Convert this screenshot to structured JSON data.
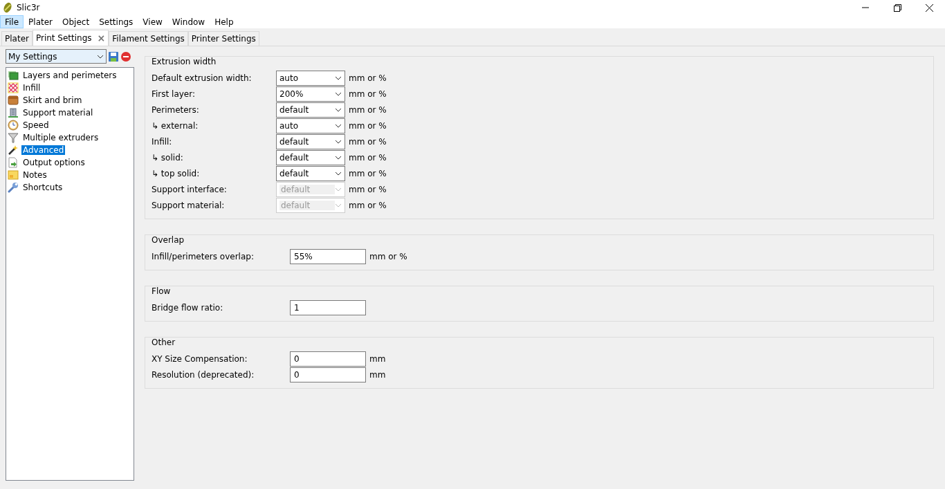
{
  "window": {
    "title": "Slic3r"
  },
  "menu": [
    {
      "label": "File",
      "selected": true
    },
    {
      "label": "Plater",
      "selected": false
    },
    {
      "label": "Object",
      "selected": false
    },
    {
      "label": "Settings",
      "selected": false
    },
    {
      "label": "View",
      "selected": false
    },
    {
      "label": "Window",
      "selected": false
    },
    {
      "label": "Help",
      "selected": false
    }
  ],
  "tabs": [
    {
      "label": "Plater",
      "selected": false
    },
    {
      "label": "Print Settings",
      "selected": true,
      "close_label": "×"
    },
    {
      "label": "Filament Settings",
      "selected": false
    },
    {
      "label": "Printer Settings",
      "selected": false
    }
  ],
  "preset": {
    "value": "My Settings"
  },
  "sidebar": {
    "items": [
      {
        "label": "Layers and perimeters",
        "selected": false
      },
      {
        "label": "Infill",
        "selected": false
      },
      {
        "label": "Skirt and brim",
        "selected": false
      },
      {
        "label": "Support material",
        "selected": false
      },
      {
        "label": "Speed",
        "selected": false
      },
      {
        "label": "Multiple extruders",
        "selected": false
      },
      {
        "label": "Advanced",
        "selected": true
      },
      {
        "label": "Output options",
        "selected": false
      },
      {
        "label": "Notes",
        "selected": false
      },
      {
        "label": "Shortcuts",
        "selected": false
      }
    ]
  },
  "sections": [
    {
      "title": "Extrusion width",
      "rows": [
        {
          "label": "Default extrusion width:",
          "kind": "combo",
          "value": "auto",
          "unit": "mm or %",
          "disabled": false
        },
        {
          "label": "First layer:",
          "kind": "combo",
          "value": "200%",
          "unit": "mm or %",
          "disabled": false
        },
        {
          "label": "Perimeters:",
          "kind": "combo",
          "value": "default",
          "unit": "mm or %",
          "disabled": false
        },
        {
          "label": "↳ external:",
          "kind": "combo",
          "value": "auto",
          "unit": "mm or %",
          "disabled": false
        },
        {
          "label": "Infill:",
          "kind": "combo",
          "value": "default",
          "unit": "mm or %",
          "disabled": false
        },
        {
          "label": "↳ solid:",
          "kind": "combo",
          "value": "default",
          "unit": "mm or %",
          "disabled": false
        },
        {
          "label": "↳ top solid:",
          "kind": "combo",
          "value": "default",
          "unit": "mm or %",
          "disabled": false
        },
        {
          "label": "Support interface:",
          "kind": "combo",
          "value": "default",
          "unit": "mm or %",
          "disabled": true
        },
        {
          "label": "Support material:",
          "kind": "combo",
          "value": "default",
          "unit": "mm or %",
          "disabled": true
        }
      ]
    },
    {
      "title": "Overlap",
      "rows": [
        {
          "label": "Infill/perimeters overlap:",
          "kind": "text",
          "value": "55%",
          "unit": "mm or %"
        }
      ]
    },
    {
      "title": "Flow",
      "rows": [
        {
          "label": "Bridge flow ratio:",
          "kind": "text",
          "value": "1"
        }
      ]
    },
    {
      "title": "Other",
      "rows": [
        {
          "label": "XY Size Compensation:",
          "kind": "text",
          "value": "0",
          "unit": "mm"
        },
        {
          "label": "Resolution (deprecated):",
          "kind": "text",
          "value": "0",
          "unit": "mm"
        }
      ]
    }
  ]
}
